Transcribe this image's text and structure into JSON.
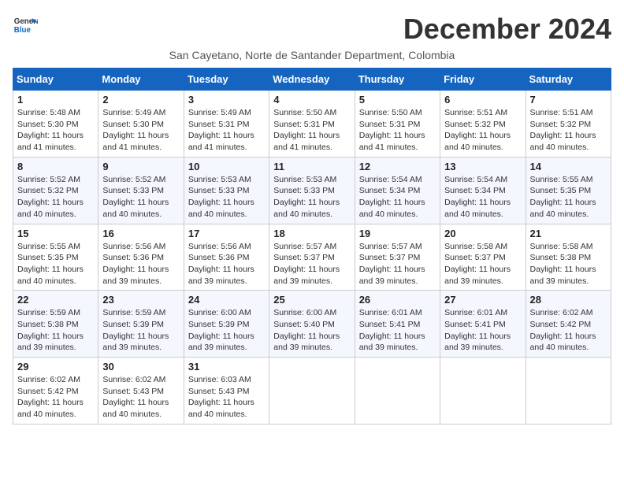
{
  "logo": {
    "general": "General",
    "blue": "Blue"
  },
  "title": "December 2024",
  "location": "San Cayetano, Norte de Santander Department, Colombia",
  "days_of_week": [
    "Sunday",
    "Monday",
    "Tuesday",
    "Wednesday",
    "Thursday",
    "Friday",
    "Saturday"
  ],
  "weeks": [
    [
      {
        "day": "1",
        "sunrise": "5:48 AM",
        "sunset": "5:30 PM",
        "daylight": "11 hours and 41 minutes."
      },
      {
        "day": "2",
        "sunrise": "5:49 AM",
        "sunset": "5:30 PM",
        "daylight": "11 hours and 41 minutes."
      },
      {
        "day": "3",
        "sunrise": "5:49 AM",
        "sunset": "5:31 PM",
        "daylight": "11 hours and 41 minutes."
      },
      {
        "day": "4",
        "sunrise": "5:50 AM",
        "sunset": "5:31 PM",
        "daylight": "11 hours and 41 minutes."
      },
      {
        "day": "5",
        "sunrise": "5:50 AM",
        "sunset": "5:31 PM",
        "daylight": "11 hours and 41 minutes."
      },
      {
        "day": "6",
        "sunrise": "5:51 AM",
        "sunset": "5:32 PM",
        "daylight": "11 hours and 40 minutes."
      },
      {
        "day": "7",
        "sunrise": "5:51 AM",
        "sunset": "5:32 PM",
        "daylight": "11 hours and 40 minutes."
      }
    ],
    [
      {
        "day": "8",
        "sunrise": "5:52 AM",
        "sunset": "5:32 PM",
        "daylight": "11 hours and 40 minutes."
      },
      {
        "day": "9",
        "sunrise": "5:52 AM",
        "sunset": "5:33 PM",
        "daylight": "11 hours and 40 minutes."
      },
      {
        "day": "10",
        "sunrise": "5:53 AM",
        "sunset": "5:33 PM",
        "daylight": "11 hours and 40 minutes."
      },
      {
        "day": "11",
        "sunrise": "5:53 AM",
        "sunset": "5:33 PM",
        "daylight": "11 hours and 40 minutes."
      },
      {
        "day": "12",
        "sunrise": "5:54 AM",
        "sunset": "5:34 PM",
        "daylight": "11 hours and 40 minutes."
      },
      {
        "day": "13",
        "sunrise": "5:54 AM",
        "sunset": "5:34 PM",
        "daylight": "11 hours and 40 minutes."
      },
      {
        "day": "14",
        "sunrise": "5:55 AM",
        "sunset": "5:35 PM",
        "daylight": "11 hours and 40 minutes."
      }
    ],
    [
      {
        "day": "15",
        "sunrise": "5:55 AM",
        "sunset": "5:35 PM",
        "daylight": "11 hours and 40 minutes."
      },
      {
        "day": "16",
        "sunrise": "5:56 AM",
        "sunset": "5:36 PM",
        "daylight": "11 hours and 39 minutes."
      },
      {
        "day": "17",
        "sunrise": "5:56 AM",
        "sunset": "5:36 PM",
        "daylight": "11 hours and 39 minutes."
      },
      {
        "day": "18",
        "sunrise": "5:57 AM",
        "sunset": "5:37 PM",
        "daylight": "11 hours and 39 minutes."
      },
      {
        "day": "19",
        "sunrise": "5:57 AM",
        "sunset": "5:37 PM",
        "daylight": "11 hours and 39 minutes."
      },
      {
        "day": "20",
        "sunrise": "5:58 AM",
        "sunset": "5:37 PM",
        "daylight": "11 hours and 39 minutes."
      },
      {
        "day": "21",
        "sunrise": "5:58 AM",
        "sunset": "5:38 PM",
        "daylight": "11 hours and 39 minutes."
      }
    ],
    [
      {
        "day": "22",
        "sunrise": "5:59 AM",
        "sunset": "5:38 PM",
        "daylight": "11 hours and 39 minutes."
      },
      {
        "day": "23",
        "sunrise": "5:59 AM",
        "sunset": "5:39 PM",
        "daylight": "11 hours and 39 minutes."
      },
      {
        "day": "24",
        "sunrise": "6:00 AM",
        "sunset": "5:39 PM",
        "daylight": "11 hours and 39 minutes."
      },
      {
        "day": "25",
        "sunrise": "6:00 AM",
        "sunset": "5:40 PM",
        "daylight": "11 hours and 39 minutes."
      },
      {
        "day": "26",
        "sunrise": "6:01 AM",
        "sunset": "5:41 PM",
        "daylight": "11 hours and 39 minutes."
      },
      {
        "day": "27",
        "sunrise": "6:01 AM",
        "sunset": "5:41 PM",
        "daylight": "11 hours and 39 minutes."
      },
      {
        "day": "28",
        "sunrise": "6:02 AM",
        "sunset": "5:42 PM",
        "daylight": "11 hours and 40 minutes."
      }
    ],
    [
      {
        "day": "29",
        "sunrise": "6:02 AM",
        "sunset": "5:42 PM",
        "daylight": "11 hours and 40 minutes."
      },
      {
        "day": "30",
        "sunrise": "6:02 AM",
        "sunset": "5:43 PM",
        "daylight": "11 hours and 40 minutes."
      },
      {
        "day": "31",
        "sunrise": "6:03 AM",
        "sunset": "5:43 PM",
        "daylight": "11 hours and 40 minutes."
      },
      null,
      null,
      null,
      null
    ]
  ]
}
